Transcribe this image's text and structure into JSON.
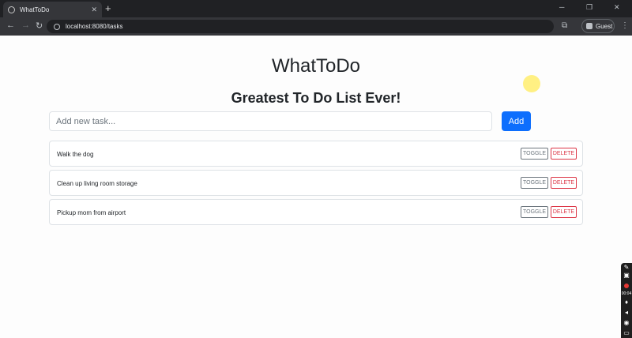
{
  "browser": {
    "tab_title": "WhatToDo",
    "tab_close": "✕",
    "new_tab": "+",
    "url": "localhost:8080/tasks",
    "profile_label": "Guest",
    "window_controls": [
      "─",
      "❐",
      "✕"
    ],
    "nav_icons": [
      "←",
      "→",
      "↻"
    ]
  },
  "app": {
    "title": "WhatToDo",
    "subtitle": "Greatest To Do List Ever!",
    "input_placeholder": "Add new task...",
    "add_label": "Add",
    "tasks": [
      {
        "label": "Walk the dog",
        "toggle": "TOGGLE",
        "delete": "DELETE"
      },
      {
        "label": "Clean up living room storage",
        "toggle": "TOGGLE",
        "delete": "DELETE"
      },
      {
        "label": "Pickup mom from airport",
        "toggle": "TOGGLE",
        "delete": "DELETE"
      }
    ]
  },
  "recorder": {
    "time": "00:04"
  },
  "colors": {
    "primary": "#0d6efd",
    "danger": "#dc3545",
    "secondary": "#6c757d"
  }
}
